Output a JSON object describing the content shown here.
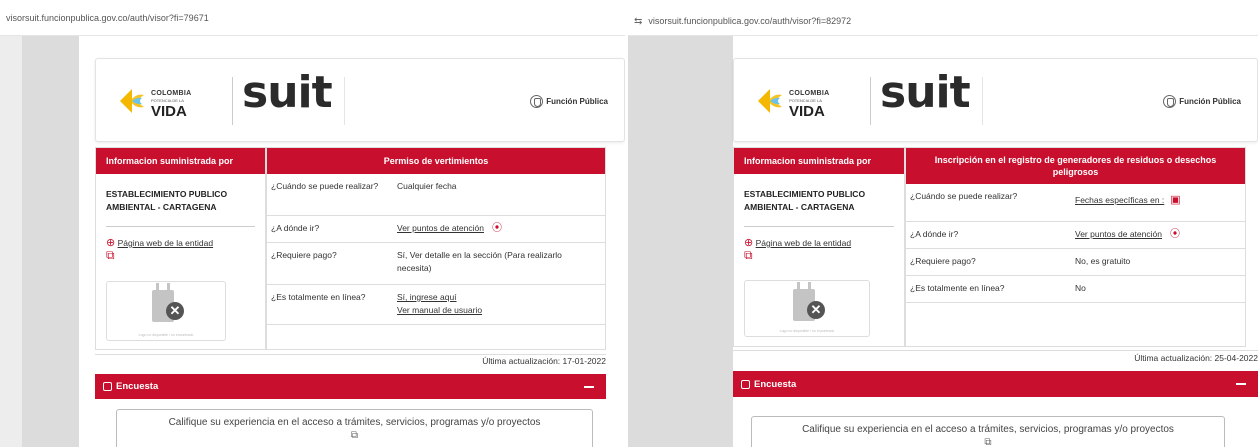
{
  "left": {
    "url": "visorsuit.funcionpublica.gov.co/auth/visor?fi=79671",
    "logo": {
      "colombia": "COLOMBIA",
      "potencia": "POTENCIA DE LA",
      "vida": "VIDA",
      "suit": "suit",
      "funcion_publica": "Función Pública"
    },
    "entity_header": "Informacion suministrada por",
    "entity_name": "ESTABLECIMIENTO PUBLICO AMBIENTAL - CARTAGENA",
    "website_link": "Página web de la entidad",
    "image_caption": "Logo no disponible / no encontrado",
    "procedure_title": "Permiso de vertimientos",
    "rows": [
      {
        "q": "¿Cuándo se puede realizar?",
        "a": "Cualquier fecha"
      },
      {
        "q": "¿A dónde ir?",
        "a": "Ver puntos de atención"
      },
      {
        "q": "¿Requiere pago?",
        "a": "Sí, Ver detalle en la sección (Para realizarlo necesita)"
      },
      {
        "q": "¿Es totalmente en línea?",
        "a": "Sí, ingrese aquí",
        "a2": "Ver manual de usuario"
      }
    ],
    "updated": "Última actualización: 17-01-2022",
    "survey_label": "Encuesta",
    "survey_text": "Califique su experiencia en el acceso a trámites, servicios, programas y/o proyectos"
  },
  "right": {
    "url": "visorsuit.funcionpublica.gov.co/auth/visor?fi=82972",
    "logo": {
      "colombia": "COLOMBIA",
      "potencia": "POTENCIA DE LA",
      "vida": "VIDA",
      "suit": "suit",
      "funcion_publica": "Función Pública"
    },
    "entity_header": "Informacion suministrada por",
    "entity_name": "ESTABLECIMIENTO PUBLICO AMBIENTAL - CARTAGENA",
    "website_link": "Página web de la entidad",
    "image_caption": "Logo no disponible / no encontrado",
    "procedure_title": "Inscripción en el registro de generadores de residuos o desechos peligrosos",
    "rows": [
      {
        "q": "¿Cuándo se puede realizar?",
        "a": "Fechas específicas en :"
      },
      {
        "q": "¿A dónde ir?",
        "a": "Ver puntos de atención"
      },
      {
        "q": "¿Requiere pago?",
        "a": "No, es gratuito"
      },
      {
        "q": "¿Es totalmente en línea?",
        "a": "No"
      }
    ],
    "updated": "Última actualización: 25-04-2022",
    "survey_label": "Encuesta",
    "survey_text": "Califique su experiencia en el acceso a trámites, servicios, programas y/o proyectos"
  },
  "colors": {
    "brand_red": "#c8102e",
    "logo_yellow": "#f5b800"
  }
}
